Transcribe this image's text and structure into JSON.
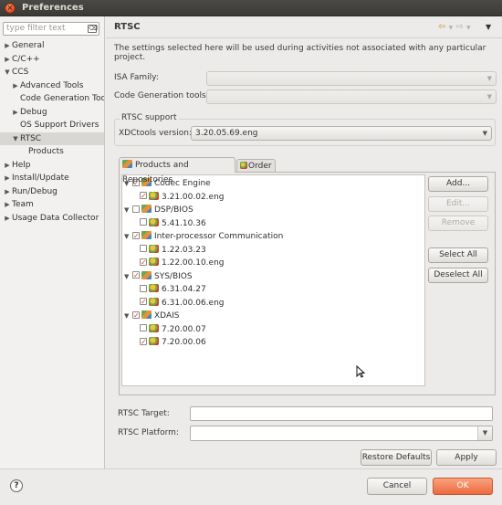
{
  "window": {
    "title": "Preferences",
    "close_glyph": "×"
  },
  "sidebar": {
    "filter_placeholder": "type filter text",
    "items": [
      {
        "label": "General",
        "arrow": "▶"
      },
      {
        "label": "C/C++",
        "arrow": "▶"
      },
      {
        "label": "CCS",
        "arrow": "▼"
      },
      {
        "label": "Advanced Tools",
        "arrow": "▶"
      },
      {
        "label": "Code Generation Tools",
        "arrow": ""
      },
      {
        "label": "Debug",
        "arrow": "▶"
      },
      {
        "label": "OS Support Drivers",
        "arrow": ""
      },
      {
        "label": "RTSC",
        "arrow": "▼"
      },
      {
        "label": "Products",
        "arrow": ""
      },
      {
        "label": "Help",
        "arrow": "▶"
      },
      {
        "label": "Install/Update",
        "arrow": "▶"
      },
      {
        "label": "Run/Debug",
        "arrow": "▶"
      },
      {
        "label": "Team",
        "arrow": "▶"
      },
      {
        "label": "Usage Data Collector",
        "arrow": "▶"
      }
    ],
    "selected": "RTSC"
  },
  "page": {
    "title": "RTSC",
    "description": "The settings selected here will be used during activities not associated with any particular project.",
    "isa_family_label": "ISA Family:",
    "isa_family_value": "",
    "codegen_label": "Code Generation tools:",
    "codegen_value": "",
    "rtsc_support_title": "RTSC support",
    "xdctools_label": "XDCtools version:",
    "xdctools_value": "3.20.05.69.eng",
    "tabs": [
      {
        "label": "Products and Repositories",
        "icon": "products-icon",
        "active": true
      },
      {
        "label": "Order",
        "icon": "order-icon",
        "active": false
      }
    ],
    "products": [
      {
        "name": "Codec Engine",
        "checked": true,
        "versions": [
          {
            "v": "3.21.00.02.eng",
            "checked": true
          }
        ]
      },
      {
        "name": "DSP/BIOS",
        "checked": false,
        "versions": [
          {
            "v": "5.41.10.36",
            "checked": false
          }
        ]
      },
      {
        "name": "Inter-processor Communication",
        "checked": true,
        "versions": [
          {
            "v": "1.22.03.23",
            "checked": false
          },
          {
            "v": "1.22.00.10.eng",
            "checked": true
          }
        ]
      },
      {
        "name": "SYS/BIOS",
        "checked": true,
        "versions": [
          {
            "v": "6.31.04.27",
            "checked": false
          },
          {
            "v": "6.31.00.06.eng",
            "checked": true
          }
        ]
      },
      {
        "name": "XDAIS",
        "checked": true,
        "versions": [
          {
            "v": "7.20.00.07",
            "checked": false
          },
          {
            "v": "7.20.00.06",
            "checked": true
          }
        ]
      }
    ],
    "buttons": {
      "add": "Add...",
      "edit": "Edit...",
      "remove": "Remove",
      "select_all": "Select All",
      "deselect_all": "Deselect All",
      "restore_defaults": "Restore Defaults",
      "apply": "Apply",
      "cancel": "Cancel",
      "ok": "OK"
    },
    "rtsc_target_label": "RTSC Target:",
    "rtsc_target_value": "",
    "rtsc_platform_label": "RTSC Platform:",
    "rtsc_platform_value": ""
  },
  "icons": {
    "back": "⇦",
    "forward": "⇨",
    "menu": "▼",
    "dropdown": "▼",
    "help": "?",
    "expand": "▼",
    "cursor": "⌶",
    "clear": "⌫"
  },
  "colors": {
    "accent_ok": "#ec6a3f",
    "check_mark": "#d6432a",
    "selection": "#d9d7d4"
  }
}
